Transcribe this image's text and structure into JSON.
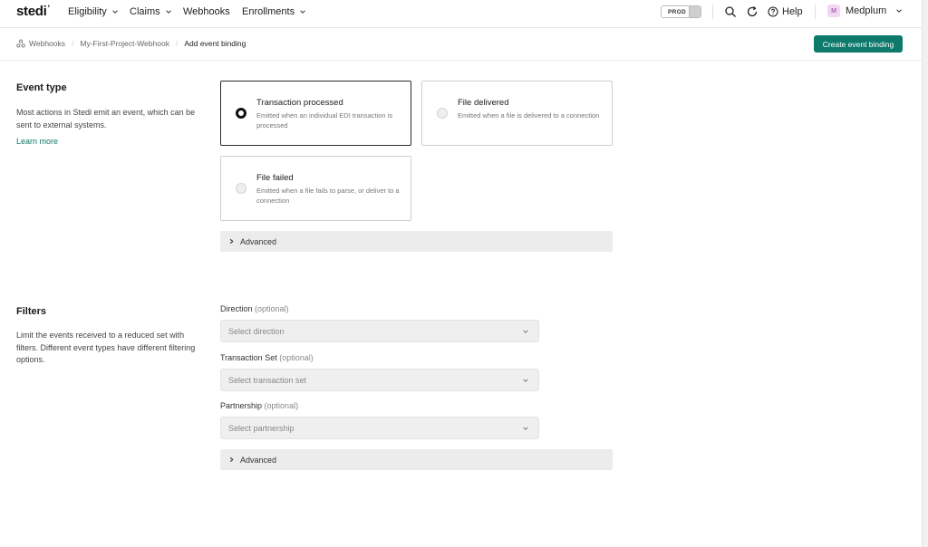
{
  "header": {
    "logo": "stedi",
    "nav": [
      {
        "label": "Eligibility",
        "dropdown": true
      },
      {
        "label": "Claims",
        "dropdown": true
      },
      {
        "label": "Webhooks",
        "dropdown": false
      },
      {
        "label": "Enrollments",
        "dropdown": true
      }
    ],
    "env_label": "PROD",
    "help_label": "Help",
    "user_initial": "M",
    "user_name": "Medplum"
  },
  "breadcrumb": {
    "items": [
      "Webhooks",
      "My-First-Project-Webhook",
      "Add event binding"
    ]
  },
  "create_button_label": "Create event binding",
  "event_type": {
    "title": "Event type",
    "description": "Most actions in Stedi emit an event, which can be sent to external systems.",
    "learn_more": "Learn more",
    "options": [
      {
        "title": "Transaction processed",
        "description": "Emitted when an individual EDI transaction is processed",
        "selected": true
      },
      {
        "title": "File delivered",
        "description": "Emitted when a file is delivered to a connection",
        "selected": false
      },
      {
        "title": "File failed",
        "description": "Emitted when a file fails to parse, or deliver to a connection",
        "selected": false
      }
    ],
    "advanced_label": "Advanced"
  },
  "filters": {
    "title": "Filters",
    "description": "Limit the events received to a reduced set with filters. Different event types have different filtering options.",
    "fields": [
      {
        "label": "Direction",
        "optional": "(optional)",
        "placeholder": "Select direction"
      },
      {
        "label": "Transaction Set",
        "optional": "(optional)",
        "placeholder": "Select transaction set"
      },
      {
        "label": "Partnership",
        "optional": "(optional)",
        "placeholder": "Select partnership"
      }
    ],
    "advanced_label": "Advanced"
  },
  "colors": {
    "accent": "#0e7a6c",
    "avatar_bg": "#f3d6f3"
  }
}
